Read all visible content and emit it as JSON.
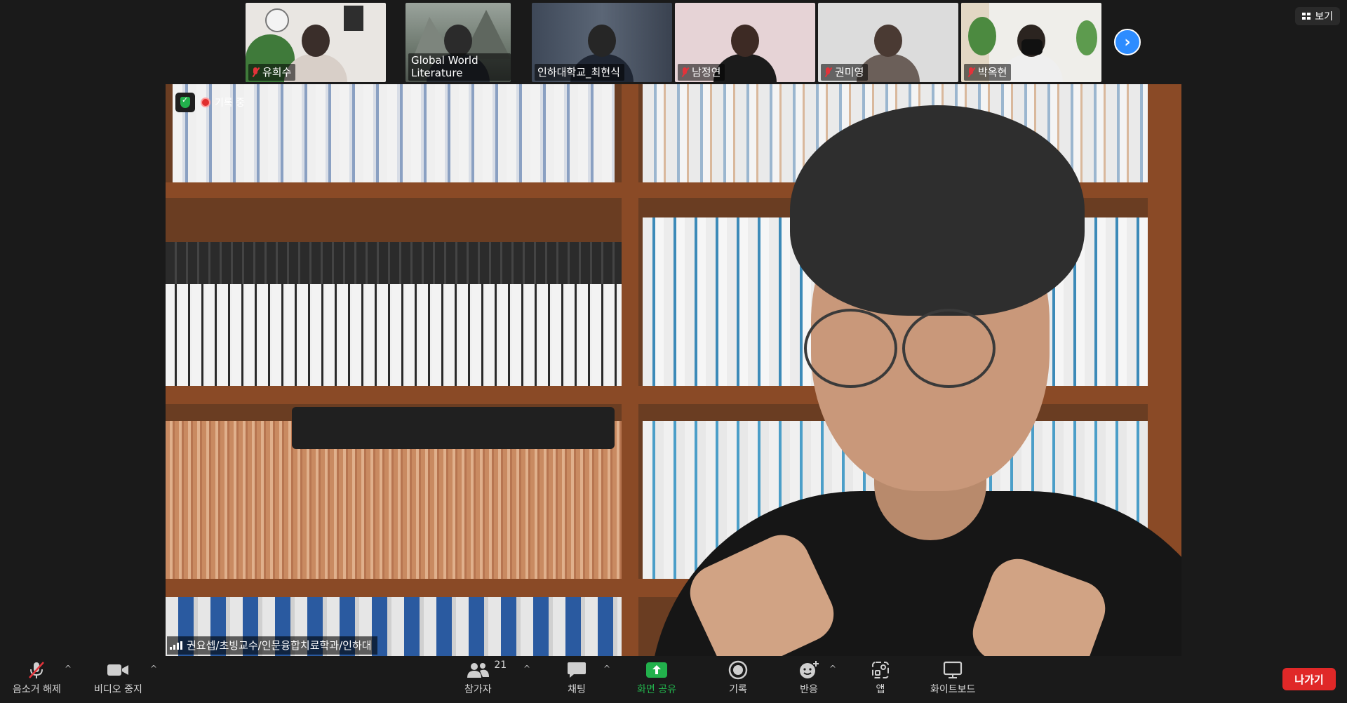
{
  "view_button": {
    "label": "보기"
  },
  "thumbnails": [
    {
      "name": "유희수",
      "muted": true
    },
    {
      "name": "Global World Literature",
      "muted": false
    },
    {
      "name": "인하대학교_최현식",
      "muted": false
    },
    {
      "name": "남정연",
      "muted": true
    },
    {
      "name": "권미영",
      "muted": true
    },
    {
      "name": "박옥현",
      "muted": true
    }
  ],
  "main_video": {
    "recording_label": "기록 중",
    "speaker_name": "권요셉/초빙교수/인문융합치료학과/인하대"
  },
  "toolbar": {
    "unmute": "음소거 해제",
    "stop_video": "비디오 중지",
    "participants": "참가자",
    "participant_count": "21",
    "chat": "채팅",
    "share_screen": "화면 공유",
    "record": "기록",
    "reactions": "반응",
    "apps": "앱",
    "whiteboard": "화이트보드",
    "leave": "나가기"
  },
  "colors": {
    "accent": "#2d8cff",
    "share_green": "#22b14c",
    "leave_red": "#e02828",
    "muted_red": "#e3333a"
  }
}
